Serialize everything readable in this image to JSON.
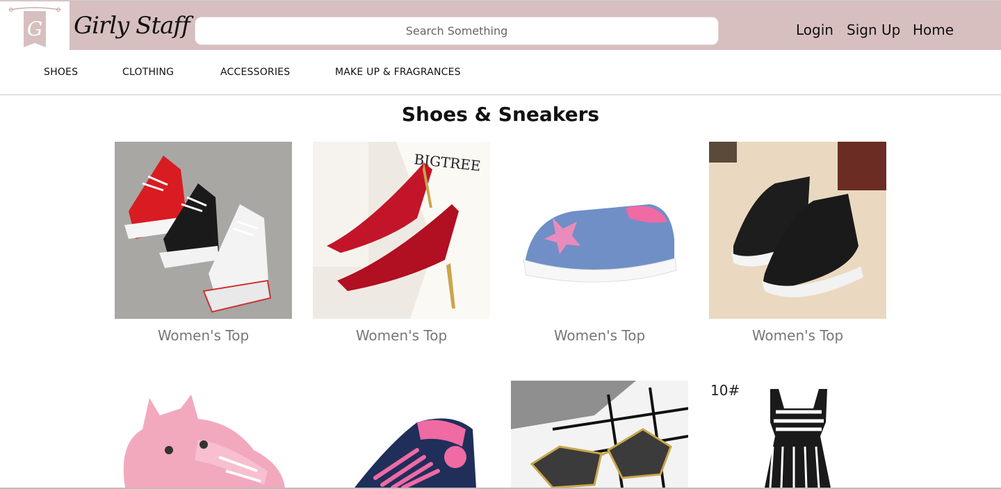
{
  "header": {
    "logo_letter": "G",
    "brand": "Girly Staff",
    "search_placeholder": "Search Something",
    "nav": [
      "Login",
      "Sign Up",
      "Home"
    ]
  },
  "categories": [
    "SHOES",
    "CLOTHING",
    "ACCESSORIES",
    "MAKE UP & FRAGRANCES"
  ],
  "section": {
    "title": "Shoes & Sneakers"
  },
  "products_row1": [
    {
      "caption": "Women's Top",
      "image": "red-black-white-sneakers"
    },
    {
      "caption": "Women's Top",
      "image": "red-stiletto-heels",
      "image_text": "BIGTREE"
    },
    {
      "caption": "Women's Top",
      "image": "denim-slip-on-glitter-star"
    },
    {
      "caption": "Women's Top",
      "image": "black-zip-shoes"
    }
  ],
  "products_row2": [
    {
      "image": "pink-fox-baby-shoes"
    },
    {
      "image": "navy-pink-sneaker"
    },
    {
      "image": "aviator-sunglasses"
    },
    {
      "image": "striped-dress",
      "image_text": "10#"
    }
  ],
  "colors": {
    "header_bg": "#d7bfbf",
    "caption": "#777777"
  }
}
